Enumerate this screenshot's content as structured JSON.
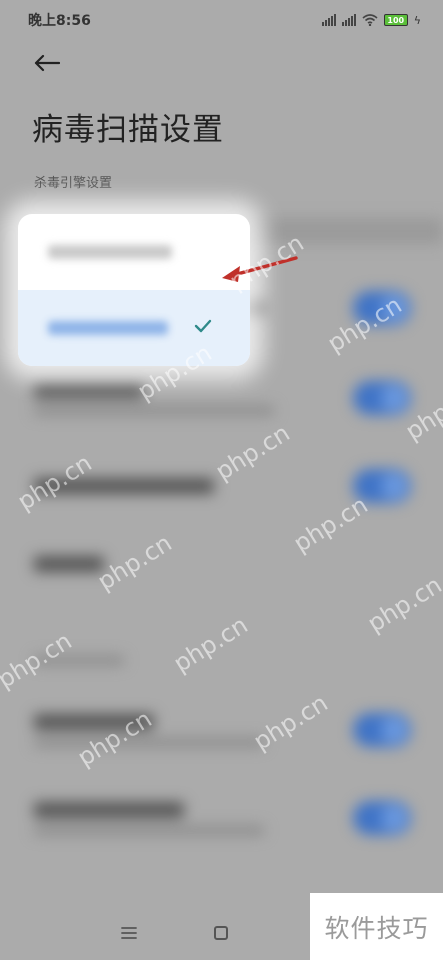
{
  "status_bar": {
    "time": "晚上8:56",
    "battery": "100"
  },
  "header": {
    "title": "病毒扫描设置",
    "section_label": "杀毒引擎设置"
  },
  "watermark_text": "php.cn",
  "watermark_logo": "软件技巧",
  "colors": {
    "background": "#ababab",
    "toggle_on": "#3f73c6",
    "selected_option_bg": "#e6f0fb",
    "check": "#2f8a8a",
    "annotation_arrow": "#c0302a"
  },
  "icons": [
    "back-arrow-icon",
    "signal-icon",
    "wifi-icon",
    "battery-icon",
    "check-icon",
    "menu-icon",
    "home-icon"
  ]
}
